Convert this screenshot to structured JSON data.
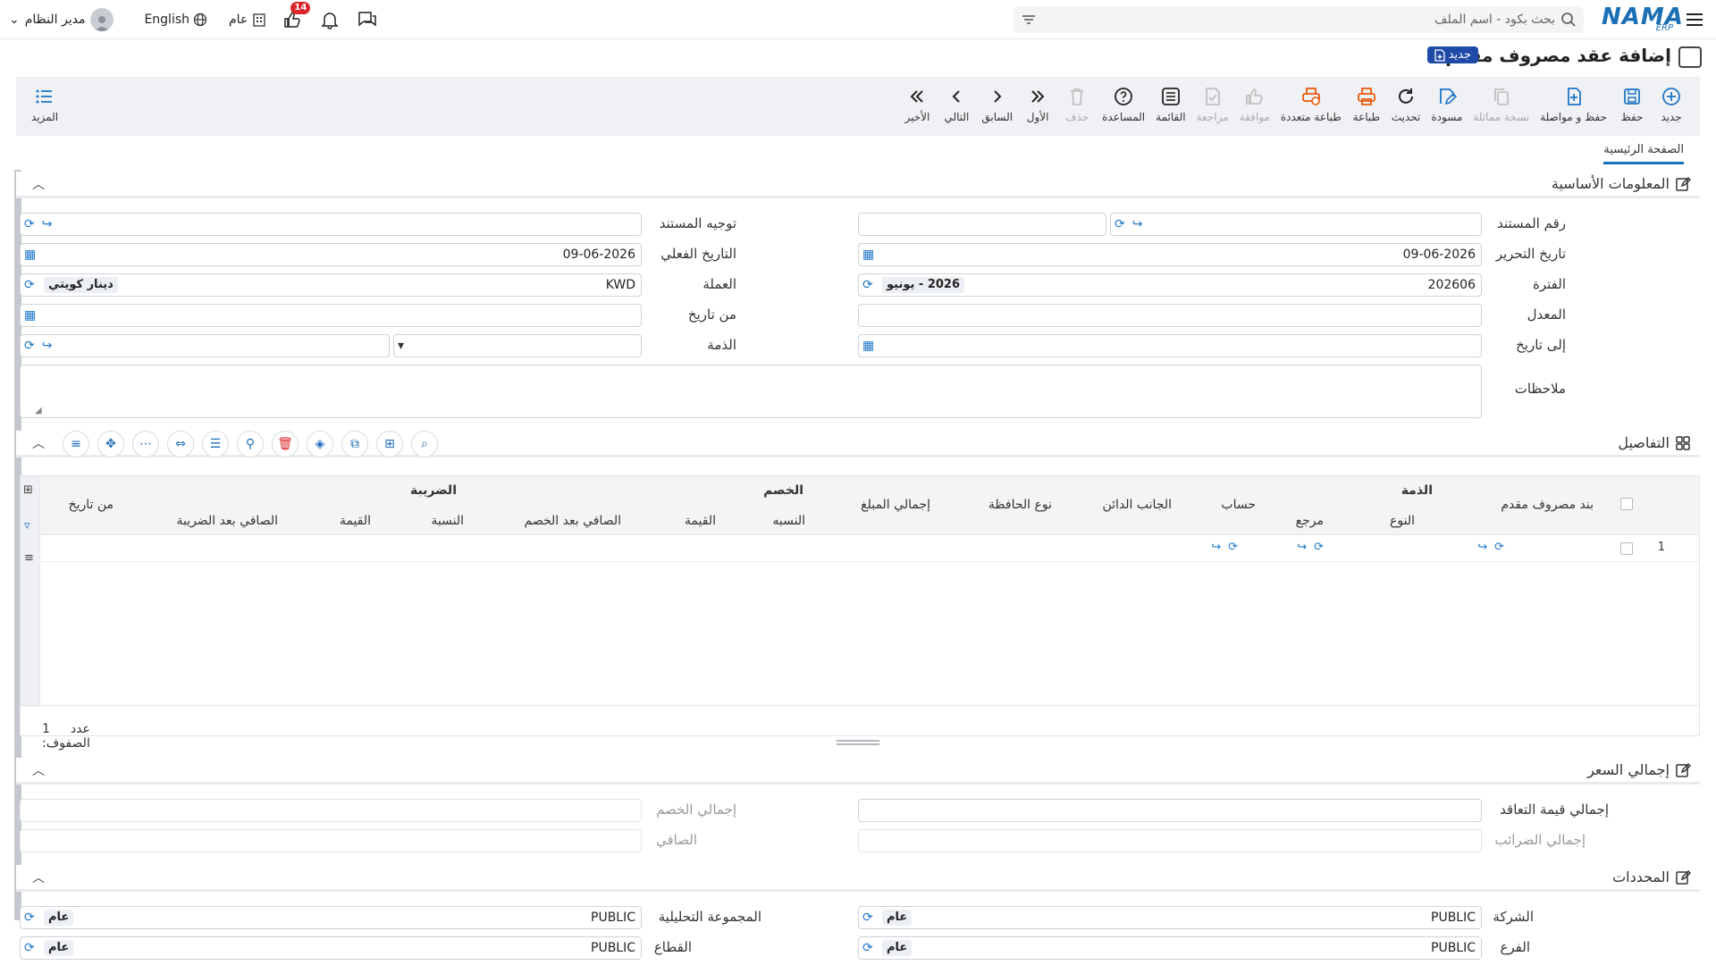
{
  "topbar": {
    "search_placeholder": "بحث بكود - اسم الملف",
    "user_name": "مدير النظام",
    "language": "English",
    "scope": "عام",
    "notifications_count": "14",
    "logo_text": "NAMA",
    "logo_sub": "ERP"
  },
  "titlebar": {
    "title": "إضافة عقد مصروف مقدم",
    "status": "جديد"
  },
  "toolbar": {
    "items": [
      {
        "label": "جديد",
        "icon": "plus-circle-icon"
      },
      {
        "label": "حفظ",
        "icon": "save-icon"
      },
      {
        "label": "حفظ و مواصلة",
        "icon": "save-continue-icon"
      },
      {
        "label": "نسخة مماثلة",
        "icon": "copy-icon"
      },
      {
        "label": "مسودة",
        "icon": "draft-icon"
      },
      {
        "label": "تحديث",
        "icon": "refresh-icon"
      },
      {
        "label": "طباعة",
        "icon": "print-icon"
      },
      {
        "label": "طباعة متعددة",
        "icon": "multi-print-icon"
      },
      {
        "label": "موافقة",
        "icon": "approve-icon"
      },
      {
        "label": "مراجعة",
        "icon": "review-icon"
      },
      {
        "label": "القائمة",
        "icon": "list-icon"
      },
      {
        "label": "المساعدة",
        "icon": "help-icon"
      },
      {
        "label": "حذف",
        "icon": "delete-icon"
      },
      {
        "label": "الأول",
        "icon": "first-icon"
      },
      {
        "label": "السابق",
        "icon": "previous-icon"
      },
      {
        "label": "التالي",
        "icon": "next-icon"
      },
      {
        "label": "الأخير",
        "icon": "last-icon"
      }
    ],
    "more_label": "المزيد"
  },
  "tabs": {
    "main": "الصفحة الرئيسية"
  },
  "sections": {
    "basic": "المعلومات الأساسية",
    "details": "التفاصيل",
    "price_total": "إجمالي السعر",
    "dimensions": "المحددات"
  },
  "basic_fields": {
    "doc_number_label": "رقم المستند",
    "doc_direction_label": "توجيه المستند",
    "edit_date_label": "تاريخ التحرير",
    "edit_date_value": "09-06-2026",
    "actual_date_label": "التاريخ الفعلي",
    "actual_date_value": "09-06-2026",
    "period_label": "الفترة",
    "period_value": "202606",
    "period_chip": "2026 - يونيو",
    "currency_label": "العملة",
    "currency_value": "KWD",
    "currency_chip": "دينار كويتي",
    "rate_label": "المعدل",
    "from_date_label": "من تاريخ",
    "to_date_label": "إلى تاريخ",
    "account_label": "الذمة",
    "notes_label": "ملاحظات"
  },
  "grid": {
    "group_headers": {
      "subsidiary": "الذمة",
      "discount": "الخصم",
      "tax": "الضريبة"
    },
    "columns": {
      "prepaid_item": "بند مصروف مقدم",
      "type": "النوع",
      "reference": "مرجع",
      "account": "حساب",
      "credit_side": "الجانب الدائن",
      "portfolio_type": "نوع الحافظة",
      "total_amount": "إجمالي المبلغ",
      "discount_rate": "النسبه",
      "discount_value": "القيمة",
      "net_after_discount": "الصافي بعد الخصم",
      "tax_rate": "النسبة",
      "tax_value": "القيمة",
      "net_after_tax": "الصافي بعد الضريبة",
      "from_date": "من تاريخ"
    },
    "row_number": "1",
    "row_count_label": "عدد الصفوف:",
    "row_count_value": "1"
  },
  "price_fields": {
    "total_contract_label": "إجمالي قيمة التعاقد",
    "total_discount_label": "إجمالي الخصم",
    "total_taxes_label": "إجمالي الضرائب",
    "net_label": "الصافي"
  },
  "dimension_fields": {
    "company_label": "الشركة",
    "company_value": "PUBLIC",
    "company_chip": "عام",
    "analytic_group_label": "المجموعة التحليلية",
    "analytic_group_value": "PUBLIC",
    "analytic_group_chip": "عام",
    "branch_label": "الفرع",
    "branch_value": "PUBLIC",
    "branch_chip": "عام",
    "sector_label": "القطاع",
    "sector_value": "PUBLIC",
    "sector_chip": "عام"
  },
  "colors": {
    "accent": "#1f77c9",
    "brand": "#1b6fb5",
    "danger": "#d9262b",
    "print": "#e8590c"
  }
}
